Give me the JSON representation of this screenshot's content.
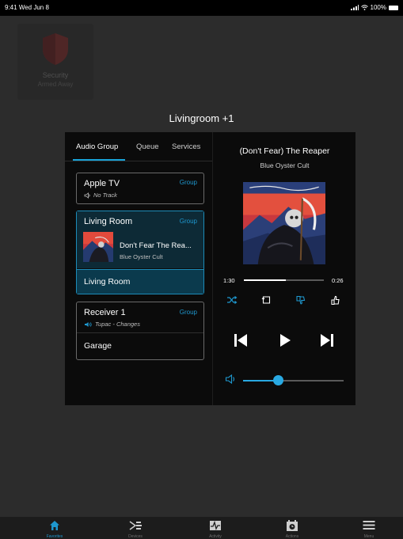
{
  "status_bar": {
    "time": "9:41",
    "date": "Wed Jun 8",
    "battery": "100%"
  },
  "background_tile": {
    "title": "Security",
    "subtitle": "Armed Away",
    "icon": "shield-icon"
  },
  "room_title": "Livingroom +1",
  "left_pane": {
    "tabs": [
      {
        "label": "Audio Group",
        "active": true
      },
      {
        "label": "Queue",
        "active": false
      },
      {
        "label": "Services",
        "active": false
      }
    ],
    "apple_tv": {
      "name": "Apple TV",
      "action": "Group",
      "status": "No Track"
    },
    "living_room": {
      "name": "Living Room",
      "action": "Group",
      "track": "Don't Fear The Rea...",
      "artist": "Blue Oyster Cult",
      "member": "Living Room"
    },
    "receiver": {
      "name": "Receiver 1",
      "action": "Group",
      "status": "Tupac - Changes",
      "member": "Garage"
    }
  },
  "now_playing": {
    "title": "(Don't Fear) The Reaper",
    "artist": "Blue Oyster Cult",
    "elapsed": "1:30",
    "remaining": "0:26",
    "progress": 0.52,
    "volume": 0.35,
    "controls": [
      "shuffle-icon",
      "repeat-icon",
      "thumbs-down-icon",
      "thumbs-up-icon"
    ],
    "transport": [
      "previous-icon",
      "play-icon",
      "next-icon"
    ]
  },
  "bottom_nav": [
    {
      "label": "Favorites",
      "icon": "home-icon",
      "active": true
    },
    {
      "label": "Devices",
      "icon": "devices-icon",
      "active": false
    },
    {
      "label": "Activity",
      "icon": "activity-icon",
      "active": false
    },
    {
      "label": "Actions",
      "icon": "clock-icon",
      "active": false
    },
    {
      "label": "Menu",
      "icon": "menu-icon",
      "active": false
    }
  ],
  "colors": {
    "accent": "#1e98cf",
    "selected_card": "#0d2a36",
    "background": "#2c2c2c",
    "modal": "#0b0b0b"
  }
}
